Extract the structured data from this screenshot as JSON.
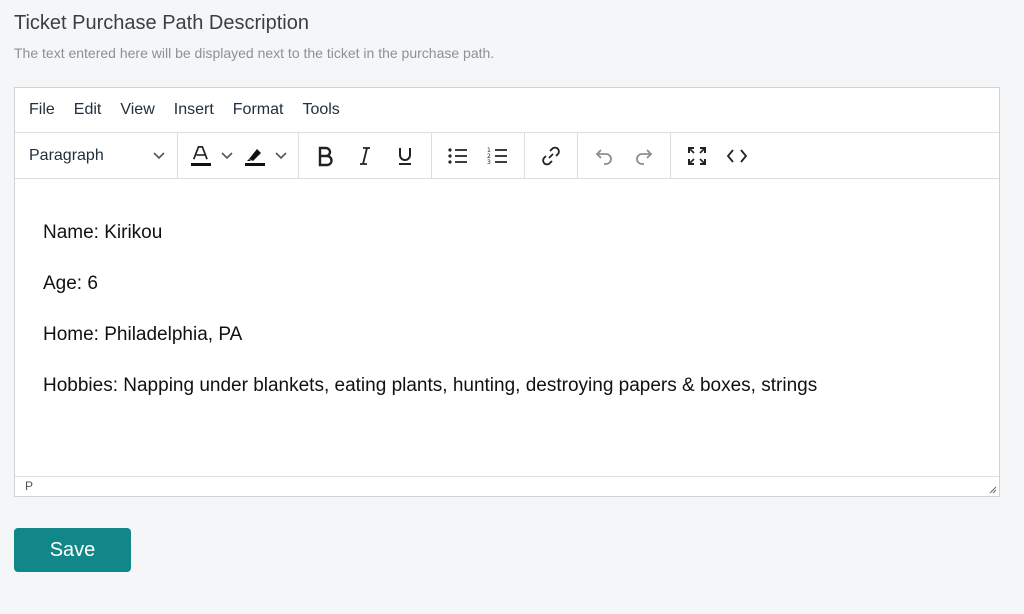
{
  "section": {
    "title": "Ticket Purchase Path Description",
    "subtitle": "The text entered here will be displayed next to the ticket in the purchase path."
  },
  "menubar": {
    "items": [
      "File",
      "Edit",
      "View",
      "Insert",
      "Format",
      "Tools"
    ]
  },
  "toolbar": {
    "block_format": "Paragraph",
    "icons": [
      "text-color-icon",
      "highlight-icon",
      "bold-icon",
      "italic-icon",
      "underline-icon",
      "bullet-list-icon",
      "numbered-list-icon",
      "link-icon",
      "undo-icon",
      "redo-icon",
      "fullscreen-icon",
      "source-code-icon"
    ],
    "colors": {
      "text_color": "#111111",
      "highlight_color": "#111111"
    }
  },
  "content": {
    "paragraphs": [
      "Name: Kirikou",
      "Age: 6",
      "Home: Philadelphia, PA",
      "Hobbies: Napping under blankets, eating plants, hunting, destroying papers & boxes, strings"
    ]
  },
  "statusbar": {
    "path": "P"
  },
  "save_label": "Save",
  "colors": {
    "accent": "#12878a",
    "border": "#cfd3d7",
    "page_bg": "#f5f6f7"
  }
}
